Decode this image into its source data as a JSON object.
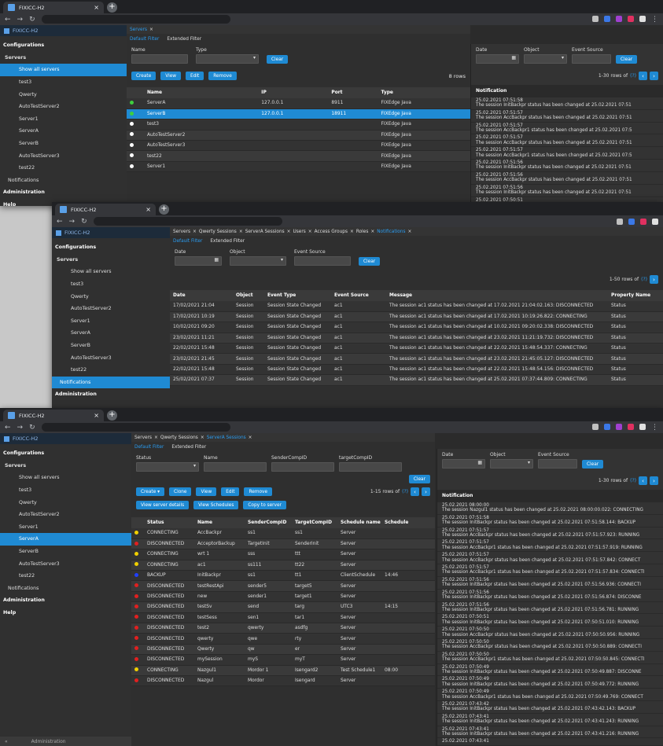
{
  "browser": {
    "tab_title": "FIXICC-H2",
    "brand": "FIXICC-H2"
  },
  "colors": {
    "accent": "#1f8ad3",
    "green": "#3ecf3e",
    "yellow": "#f0d000",
    "red": "#e02020",
    "blue": "#2040ff",
    "white": "#ffffff"
  },
  "win1": {
    "main_tab": "Servers",
    "filter_tabs": [
      "Default Filter",
      "Extended Filter"
    ],
    "name_label": "Name",
    "type_label": "Type",
    "clear": "Clear",
    "create": "Create",
    "view": "View",
    "edit": "Edit",
    "remove": "Remove",
    "rows": "8 rows",
    "cols": [
      "Name",
      "IP",
      "Port",
      "Type"
    ],
    "rows_data": [
      {
        "c": "green",
        "n": "ServerA",
        "ip": "127.0.0.1",
        "port": "8911",
        "type": "FIXEdge Java"
      },
      {
        "c": "green",
        "n": "ServerB",
        "ip": "127.0.0.1",
        "port": "18911",
        "type": "FIXEdge Java",
        "sel": true
      },
      {
        "c": "white",
        "n": "test3",
        "ip": "",
        "port": "",
        "type": "FIXEdge Java"
      },
      {
        "c": "white",
        "n": "AutoTestServer2",
        "ip": "",
        "port": "",
        "type": "FIXEdge Java"
      },
      {
        "c": "white",
        "n": "AutoTestServer3",
        "ip": "",
        "port": "",
        "type": "FIXEdge Java"
      },
      {
        "c": "white",
        "n": "test22",
        "ip": "",
        "port": "",
        "type": "FIXEdge Java"
      },
      {
        "c": "white",
        "n": "Server1",
        "ip": "",
        "port": "",
        "type": "FIXEdge Java"
      }
    ],
    "side": [
      "Configurations",
      "Servers",
      "Show all servers",
      "test3",
      "Qwerty",
      "AutoTestServer2",
      "Server1",
      "ServerA",
      "ServerB",
      "AutoTestServer3",
      "test22",
      "Notifications",
      "Administration",
      "Help"
    ],
    "notif": {
      "date": "Date",
      "object": "Object",
      "event_source": "Event Source",
      "clear": "Clear",
      "pager": "1-30 rows of",
      "pager_count": "(?)",
      "head": "Notification",
      "items": [
        [
          "25.02.2021 07:51:58",
          "The session InitBackpr status has been changed at 25.02.2021 07:51"
        ],
        [
          "25.02.2021 07:51:57",
          "The session AccBackpr status has been changed at 25.02.2021 07:51"
        ],
        [
          "25.02.2021 07:51:57",
          "The session AccBackpr1 status has been changed at 25.02.2021 07:5"
        ],
        [
          "25.02.2021 07:51:57",
          "The session AccBackpr status has been changed at 25.02.2021 07:51"
        ],
        [
          "25.02.2021 07:51:57",
          "The session AccBackpr1 status has been changed at 25.02.2021 07:5"
        ],
        [
          "25.02.2021 07:51:56",
          "The session InitBackpr status has been changed at 25.02.2021 07:51"
        ],
        [
          "25.02.2021 07:51:56",
          "The session AccBackpr status has been changed at 25.02.2021 07:51"
        ],
        [
          "25.02.2021 07:51:56",
          "The session InitBackpr status has been changed at 25.02.2021 07:51"
        ],
        [
          "25.02.2021 07:50:51",
          ""
        ]
      ]
    }
  },
  "win2": {
    "tabs": [
      "Servers",
      "Qwerty Sessions",
      "ServerA Sessions",
      "Users",
      "Access Groups",
      "Roles",
      "Notifications"
    ],
    "filter_tabs": [
      "Default Filter",
      "Extended Filter"
    ],
    "date": "Date",
    "object": "Object",
    "event_source": "Event Source",
    "clear": "Clear",
    "pager": "1-50 rows of",
    "pager_count": "(?)",
    "cols": [
      "Date",
      "Object",
      "Event Type",
      "Event Source",
      "Message",
      "Property Name"
    ],
    "rows": [
      [
        "17/02/2021 21:04",
        "Session",
        "Session State Changed",
        "ac1",
        "The session ac1 status has been changed at 17.02.2021 21:04:02.163: DISCONNECTED",
        "Status"
      ],
      [
        "17/02/2021 10:19",
        "Session",
        "Session State Changed",
        "ac1",
        "The session ac1 status has been changed at 17.02.2021 10:19:26.822: CONNECTING",
        "Status"
      ],
      [
        "10/02/2021 09:20",
        "Session",
        "Session State Changed",
        "ac1",
        "The session ac1 status has been changed at 10.02.2021 09:20:02.338: DISCONNECTED",
        "Status"
      ],
      [
        "23/02/2021 11:21",
        "Session",
        "Session State Changed",
        "ac1",
        "The session ac1 status has been changed at 23.02.2021 11:21:19.732: DISCONNECTED",
        "Status"
      ],
      [
        "22/02/2021 15:48",
        "Session",
        "Session State Changed",
        "ac1",
        "The session ac1 status has been changed at 22.02.2021 15:48:54.337: CONNECTING",
        "Status"
      ],
      [
        "23/02/2021 21:45",
        "Session",
        "Session State Changed",
        "ac1",
        "The session ac1 status has been changed at 23.02.2021 21:45:05.127: DISCONNECTED",
        "Status"
      ],
      [
        "22/02/2021 15:48",
        "Session",
        "Session State Changed",
        "ac1",
        "The session ac1 status has been changed at 22.02.2021 15:48:54.156: DISCONNECTED",
        "Status"
      ],
      [
        "25/02/2021 07:37",
        "Session",
        "Session State Changed",
        "ac1",
        "The session ac1 status has been changed at 25.02.2021 07:37:44.809: CONNECTING",
        "Status"
      ]
    ],
    "side": [
      "Configurations",
      "Servers",
      "Show all servers",
      "test3",
      "Qwerty",
      "AutoTestServer2",
      "Server1",
      "ServerA",
      "ServerB",
      "AutoTestServer3",
      "test22",
      "Notifications",
      "Administration"
    ]
  },
  "win3": {
    "tabs": [
      "Servers",
      "Qwerty Sessions",
      "ServerA Sessions"
    ],
    "filter_tabs": [
      "Default Filter",
      "Extended Filter"
    ],
    "f_status": "Status",
    "f_name": "Name",
    "f_sender": "SenderCompID",
    "f_target": "targetCompID",
    "clear": "Clear",
    "create": "Create",
    "clone": "Clone",
    "view": "View",
    "edit": "Edit",
    "remove": "Remove",
    "pager": "1-15 rows of",
    "pager_count": "(?)",
    "view_details": "View server details",
    "view_schedules": "View Schedules",
    "copy": "Copy to server",
    "cols": [
      "Status",
      "Name",
      "SenderCompID",
      "TargetCompID",
      "Schedule name",
      "Schedule"
    ],
    "rows": [
      [
        "yellow",
        "CONNECTING",
        "AccBackpr",
        "ss1",
        "ss1",
        "Server",
        ""
      ],
      [
        "red",
        "DISCONNECTED",
        "AcceptorBackup",
        "TargetInit",
        "SenderInit",
        "Server",
        ""
      ],
      [
        "yellow",
        "CONNECTING",
        "wrt 1",
        "sss",
        "ttt",
        "Server",
        ""
      ],
      [
        "yellow",
        "CONNECTING",
        "ac1",
        "ss111",
        "tt22",
        "Server",
        ""
      ],
      [
        "blue",
        "BACKUP",
        "InitBackpr",
        "ss1",
        "tt1",
        "ClientSchedule",
        "14:46"
      ],
      [
        "red",
        "DISCONNECTED",
        "testRestApi",
        "sender5",
        "target5",
        "Server",
        ""
      ],
      [
        "red",
        "DISCONNECTED",
        "new",
        "sender1",
        "target1",
        "Server",
        ""
      ],
      [
        "red",
        "DISCONNECTED",
        "testSv",
        "send",
        "targ",
        "UTC3",
        "14:15"
      ],
      [
        "red",
        "DISCONNECTED",
        "testSess",
        "sen1",
        "tar1",
        "Server",
        ""
      ],
      [
        "red",
        "DISCONNECTED",
        "test2",
        "qwerty",
        "asdfg",
        "Server",
        ""
      ],
      [
        "red",
        "DISCONNECTED",
        "qwerty",
        "qwe",
        "rty",
        "Server",
        ""
      ],
      [
        "red",
        "DISCONNECTED",
        "Qwerty",
        "qw",
        "er",
        "Server",
        ""
      ],
      [
        "red",
        "DISCONNECTED",
        "mySession",
        "myS",
        "myT",
        "Server",
        ""
      ],
      [
        "yellow",
        "CONNECTING",
        "Nazgul1",
        "Mordor 1",
        "Isengard2",
        "Test Schedule1",
        "08:00"
      ],
      [
        "red",
        "DISCONNECTED",
        "Nazgul",
        "Mordor",
        "Isengard",
        "Server",
        ""
      ]
    ],
    "side": [
      "Configurations",
      "Servers",
      "Show all servers",
      "test3",
      "Qwerty",
      "AutoTestServer2",
      "Server1",
      "ServerA",
      "ServerB",
      "AutoTestServer3",
      "test22",
      "Notifications",
      "Administration",
      "Help"
    ],
    "footer": "Administration",
    "notif": {
      "date": "Date",
      "object": "Object",
      "event_source": "Event Source",
      "clear": "Clear",
      "pager": "1-30 rows of",
      "pager_count": "(?)",
      "head": "Notification",
      "items": [
        [
          "25.02.2021 08:00:00",
          "The session Nazgul1 status has been changed at 25.02.2021 08:00:00.022: CONNECTING"
        ],
        [
          "25.02.2021 07:51:58",
          "The session InitBackpr status has been changed at 25.02.2021 07:51:58.144: BACKUP"
        ],
        [
          "25.02.2021 07:51:57",
          "The session AccBackpr status has been changed at 25.02.2021 07:51:57.923: RUNNING"
        ],
        [
          "25.02.2021 07:51:57",
          "The session AccBackpr1 status has been changed at 25.02.2021 07:51:57.919: RUNNING"
        ],
        [
          "25.02.2021 07:51:57",
          "The session AccBackpr status has been changed at 25.02.2021 07:51:57.842: CONNECT"
        ],
        [
          "25.02.2021 07:51:57",
          "The session AccBackpr1 status has been changed at 25.02.2021 07:51:57.834: CONNECTI"
        ],
        [
          "25.02.2021 07:51:56",
          "The session InitBackpr status has been changed at 25.02.2021 07:51:56.936: CONNECTI"
        ],
        [
          "25.02.2021 07:51:56",
          "The session InitBackpr status has been changed at 25.02.2021 07:51:56.874: DISCONNE"
        ],
        [
          "25.02.2021 07:51:56",
          "The session InitBackpr status has been changed at 25.02.2021 07:51:56.781: RUNNING"
        ],
        [
          "25.02.2021 07:50:51",
          "The session InitBackpr status has been changed at 25.02.2021 07:50:51.010: RUNNING"
        ],
        [
          "25.02.2021 07:50:50",
          "The session AccBackpr status has been changed at 25.02.2021 07:50:50.956: RUNNING"
        ],
        [
          "25.02.2021 07:50:50",
          "The session AccBackpr status has been changed at 25.02.2021 07:50:50.889: CONNECTI"
        ],
        [
          "25.02.2021 07:50:50",
          "The session AccBackpr1 status has been changed at 25.02.2021 07:50:50.845: CONNECTI"
        ],
        [
          "25.02.2021 07:50:49",
          "The session InitBackpr status has been changed at 25.02.2021 07:50:49.887: DISCONNE"
        ],
        [
          "25.02.2021 07:50:49",
          "The session InitBackpr status has been changed at 25.02.2021 07:50:49.772: RUNNING"
        ],
        [
          "25.02.2021 07:50:49",
          "The session AccBackpr1 status has been changed at 25.02.2021 07:50:49.769: CONNECT"
        ],
        [
          "25.02.2021 07:43:42",
          "The session InitBackpr status has been changed at 25.02.2021 07:43:42.143: BACKUP"
        ],
        [
          "25.02.2021 07:43:41",
          "The session InitBackpr status has been changed at 25.02.2021 07:43:41.243: RUNNING"
        ],
        [
          "25.02.2021 07:43:41",
          "The session InitBackpr status has been changed at 25.02.2021 07:43:41.216: RUNNING"
        ],
        [
          "25.02.2021 07:43:41",
          ""
        ]
      ]
    }
  }
}
